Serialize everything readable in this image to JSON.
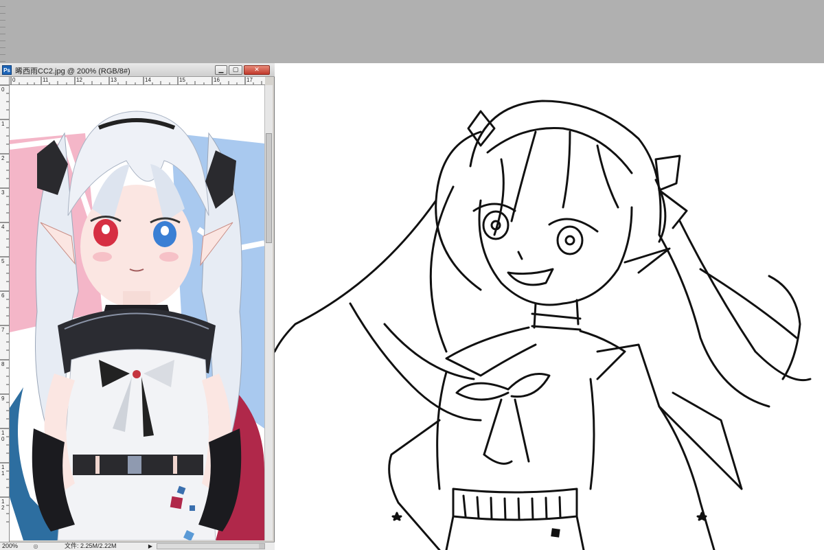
{
  "document": {
    "app_badge": "Ps",
    "title": "晞西雨CC2.jpg @ 200% (RGB/8#)",
    "window_buttons": {
      "minimize": "▁",
      "maximize": "▢",
      "close": "✕"
    }
  },
  "rulers": {
    "horizontal_labels": [
      "0",
      "11",
      "12",
      "13",
      "14",
      "15",
      "16",
      "17"
    ],
    "vertical_labels": [
      "0",
      "1",
      "2",
      "3",
      "4",
      "5",
      "6",
      "7",
      "8",
      "9",
      "1 0",
      "1 1",
      "1 2"
    ]
  },
  "status": {
    "zoom": "200%",
    "file_info": "文件: 2.25M/2.22M",
    "menu_arrow": "▶"
  },
  "colors": {
    "workspace_bg": "#b0b0b0",
    "titlebar_bg": "#d9d9d9",
    "close_button": "#c0392b",
    "bg_pink": "#f4b6c8",
    "bg_blue": "#a9c9ef",
    "hair": "#e7ecf4",
    "eye_left": "#d62f43",
    "eye_right": "#3a7fd4",
    "jacket_blue": "#2d6ea0",
    "jacket_red": "#b0284a"
  }
}
